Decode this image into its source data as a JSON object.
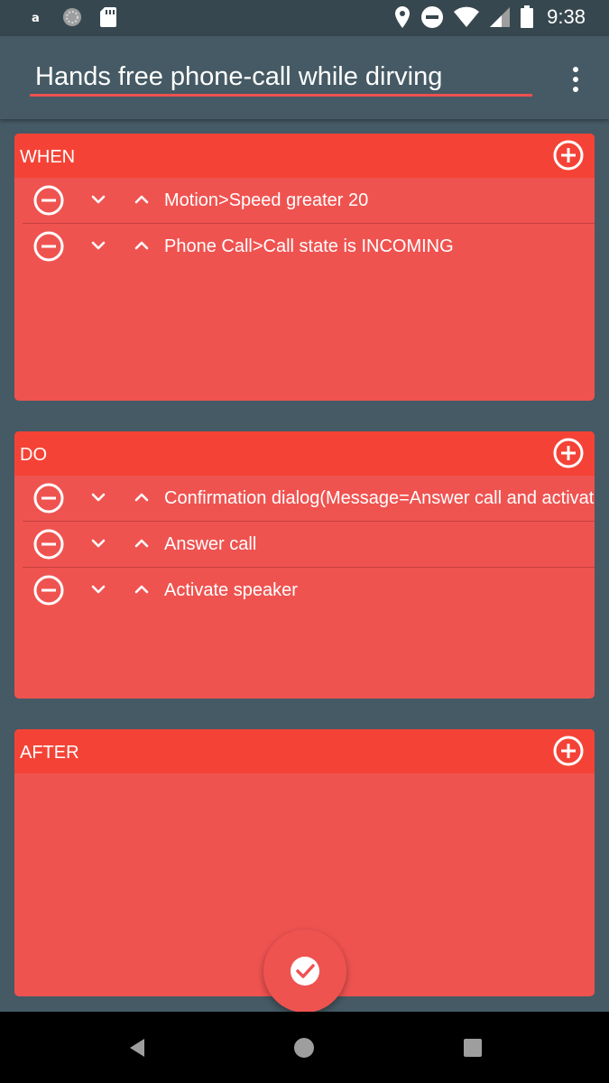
{
  "status_bar": {
    "time": "9:38",
    "left_icons": [
      "translate-icon",
      "sync-icon",
      "sd-card-icon"
    ],
    "right_icons": [
      "location-icon",
      "do-not-disturb-icon",
      "wifi-icon",
      "signal-icon",
      "battery-icon"
    ]
  },
  "app_bar": {
    "title": "Hands free phone-call while dirving",
    "menu_icon": "more-vert-icon"
  },
  "colors": {
    "background": "#455a64",
    "card": "#ef5350",
    "card_header": "#f44336",
    "accent_underline": "#f0504f"
  },
  "sections": {
    "when": {
      "title": "WHEN",
      "items": [
        {
          "label": "Motion>Speed greater 20"
        },
        {
          "label": "Phone Call>Call state is INCOMING"
        }
      ]
    },
    "do": {
      "title": "DO",
      "items": [
        {
          "label": "Confirmation dialog(Message=Answer call and activate speaker?)"
        },
        {
          "label": "Answer call"
        },
        {
          "label": "Activate speaker"
        }
      ]
    },
    "after": {
      "title": "AFTER",
      "items": []
    }
  },
  "fab": {
    "icon": "check-icon"
  },
  "nav_bar": {
    "icons": [
      "back-icon",
      "home-icon",
      "recents-icon"
    ]
  }
}
